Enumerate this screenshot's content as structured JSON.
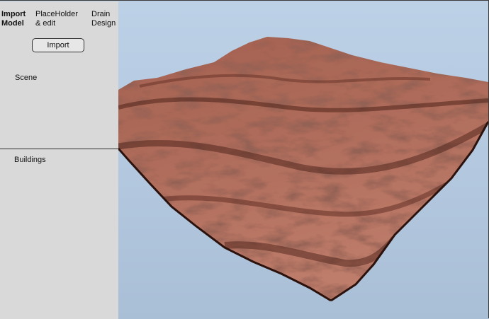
{
  "tabs": [
    {
      "label": "Import\nModel",
      "active": true
    },
    {
      "label": "PlaceHolder\n& edit",
      "active": false
    },
    {
      "label": "Drain\nDesign",
      "active": false
    }
  ],
  "import_button": "Import",
  "sections": {
    "scene": "Scene",
    "buildings": "Buildings"
  },
  "colors": {
    "sidebar": "#d9d9d9",
    "viewport_bg": "#b9cde3",
    "terrain_light": "#b0705e",
    "terrain_dark": "#4a2018"
  }
}
